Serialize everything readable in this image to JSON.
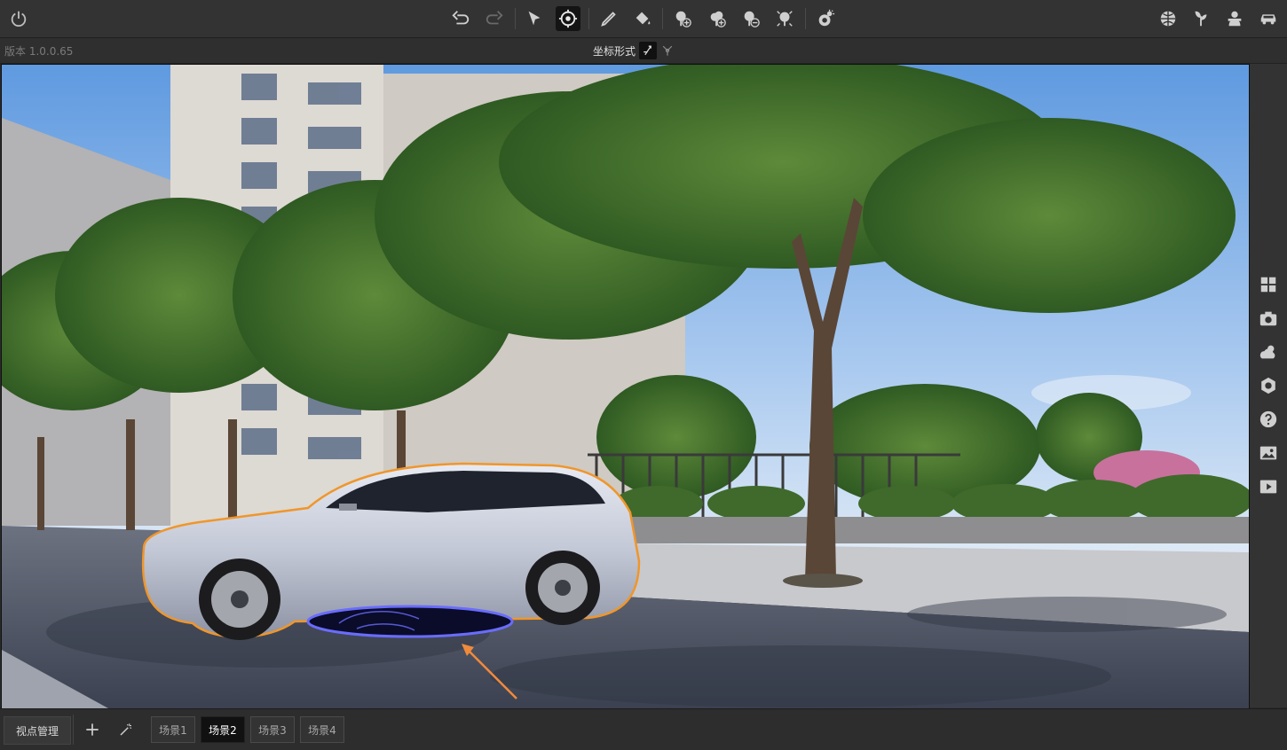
{
  "app": {
    "version": "版本 1.0.0.65"
  },
  "toolbar": {
    "left_icons": [
      "power-icon"
    ],
    "center_icons": [
      "undo-icon",
      "redo-icon",
      "select-arrow-icon",
      "orbit-target-icon",
      "pen-icon",
      "paint-bucket-icon",
      "tree-add-icon",
      "tree-add-alt-icon",
      "tree-remove-icon",
      "tree-scatter-icon",
      "weather-icon"
    ],
    "right_icons": [
      "globe-icon",
      "plant-icon",
      "character-icon",
      "car-icon"
    ]
  },
  "coord": {
    "label": "坐标形式",
    "modes": [
      "axis-local-icon",
      "axis-world-icon"
    ]
  },
  "sidebar": {
    "icons": [
      "grid-icon",
      "camera-icon",
      "weather-icon",
      "settings-icon",
      "help-icon",
      "image-icon",
      "play-icon"
    ]
  },
  "bottom": {
    "viewpoint_label": "视点管理",
    "add_icon": "plus-icon",
    "magic_icon": "magic-wand-icon",
    "scenes": [
      {
        "label": "场景1",
        "active": false
      },
      {
        "label": "场景2",
        "active": true
      },
      {
        "label": "场景3",
        "active": false
      },
      {
        "label": "场景4",
        "active": false
      }
    ]
  },
  "colors": {
    "accent_outline": "#f0962a",
    "decal_ring": "#6a6cff",
    "arrow": "#f08a3c"
  }
}
